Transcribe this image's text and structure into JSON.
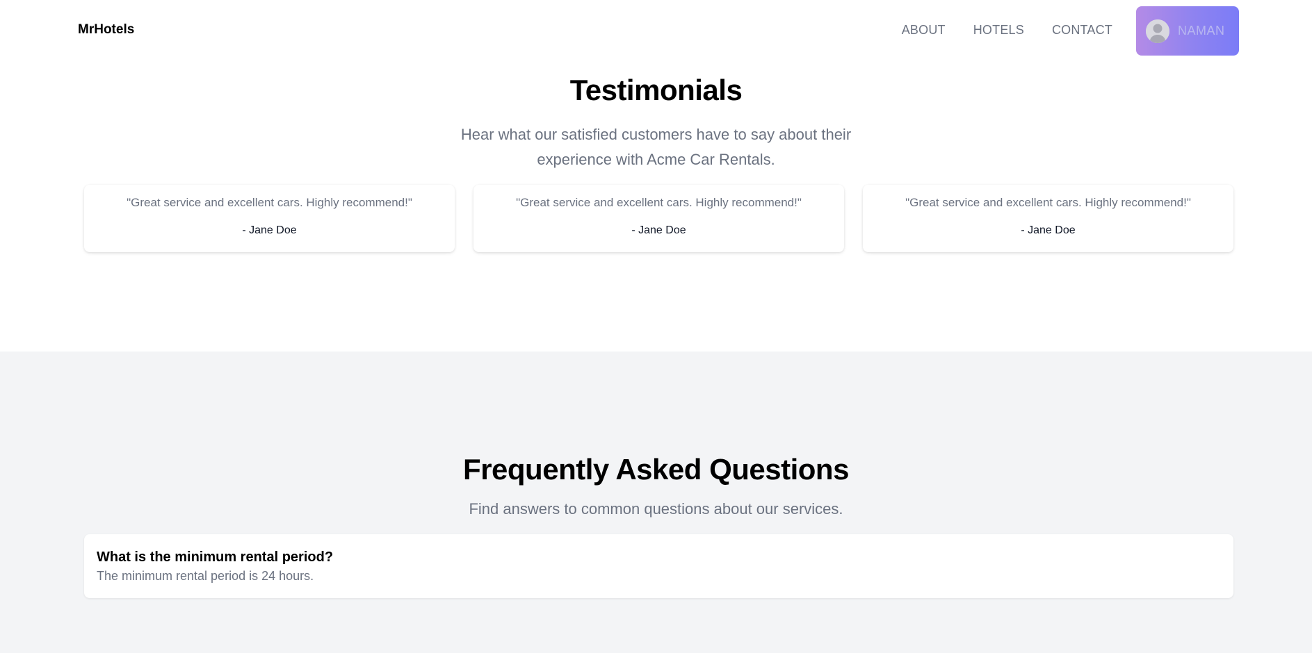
{
  "header": {
    "brand": "MrHotels",
    "nav": [
      {
        "label": "ABOUT"
      },
      {
        "label": "HOTELS"
      },
      {
        "label": "CONTACT"
      }
    ],
    "user": {
      "name": "NAMAN",
      "avatar_icon": "user-avatar-icon"
    },
    "accent_gradient": [
      "#b48be6",
      "#7b7cf7"
    ]
  },
  "testimonials": {
    "title": "Testimonials",
    "subtitle": "Hear what our satisfied customers have to say about their experience with Acme Car Rentals.",
    "items": [
      {
        "quote": "\"Great service and excellent cars. Highly recommend!\"",
        "author": "- Jane Doe"
      },
      {
        "quote": "\"Great service and excellent cars. Highly recommend!\"",
        "author": "- Jane Doe"
      },
      {
        "quote": "\"Great service and excellent cars. Highly recommend!\"",
        "author": "- Jane Doe"
      }
    ]
  },
  "faq": {
    "title": "Frequently Asked Questions",
    "subtitle": "Find answers to common questions about our services.",
    "items": [
      {
        "question": "What is the minimum rental period?",
        "answer": "The minimum rental period is 24 hours."
      }
    ]
  },
  "colors": {
    "muted_text": "#6b7280",
    "faq_background": "#f3f4f6"
  }
}
